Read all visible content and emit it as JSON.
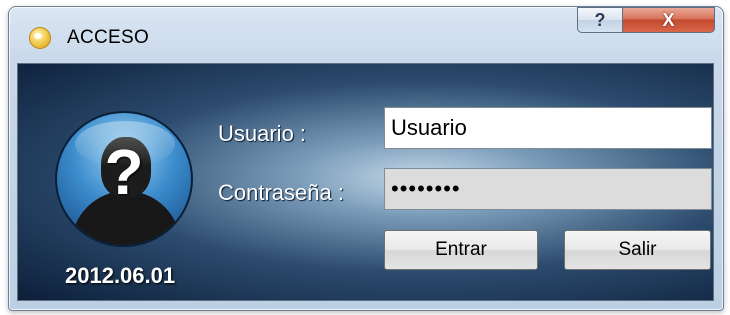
{
  "window": {
    "title": "ACCESO",
    "icon": "app-circle-icon",
    "help_label": "?",
    "close_label": "X"
  },
  "form": {
    "username_label": "Usuario :",
    "username_value": "Usuario",
    "password_label": "Contraseña :",
    "password_value": "••••••••",
    "enter_label": "Entrar",
    "exit_label": "Salir"
  },
  "avatar": {
    "mark": "?",
    "icon": "unknown-user-icon"
  },
  "date": "2012.06.01",
  "colors": {
    "panel_dark": "#0c1f3a",
    "panel_light": "#c4d8e8",
    "close_red": "#c44a2f"
  }
}
